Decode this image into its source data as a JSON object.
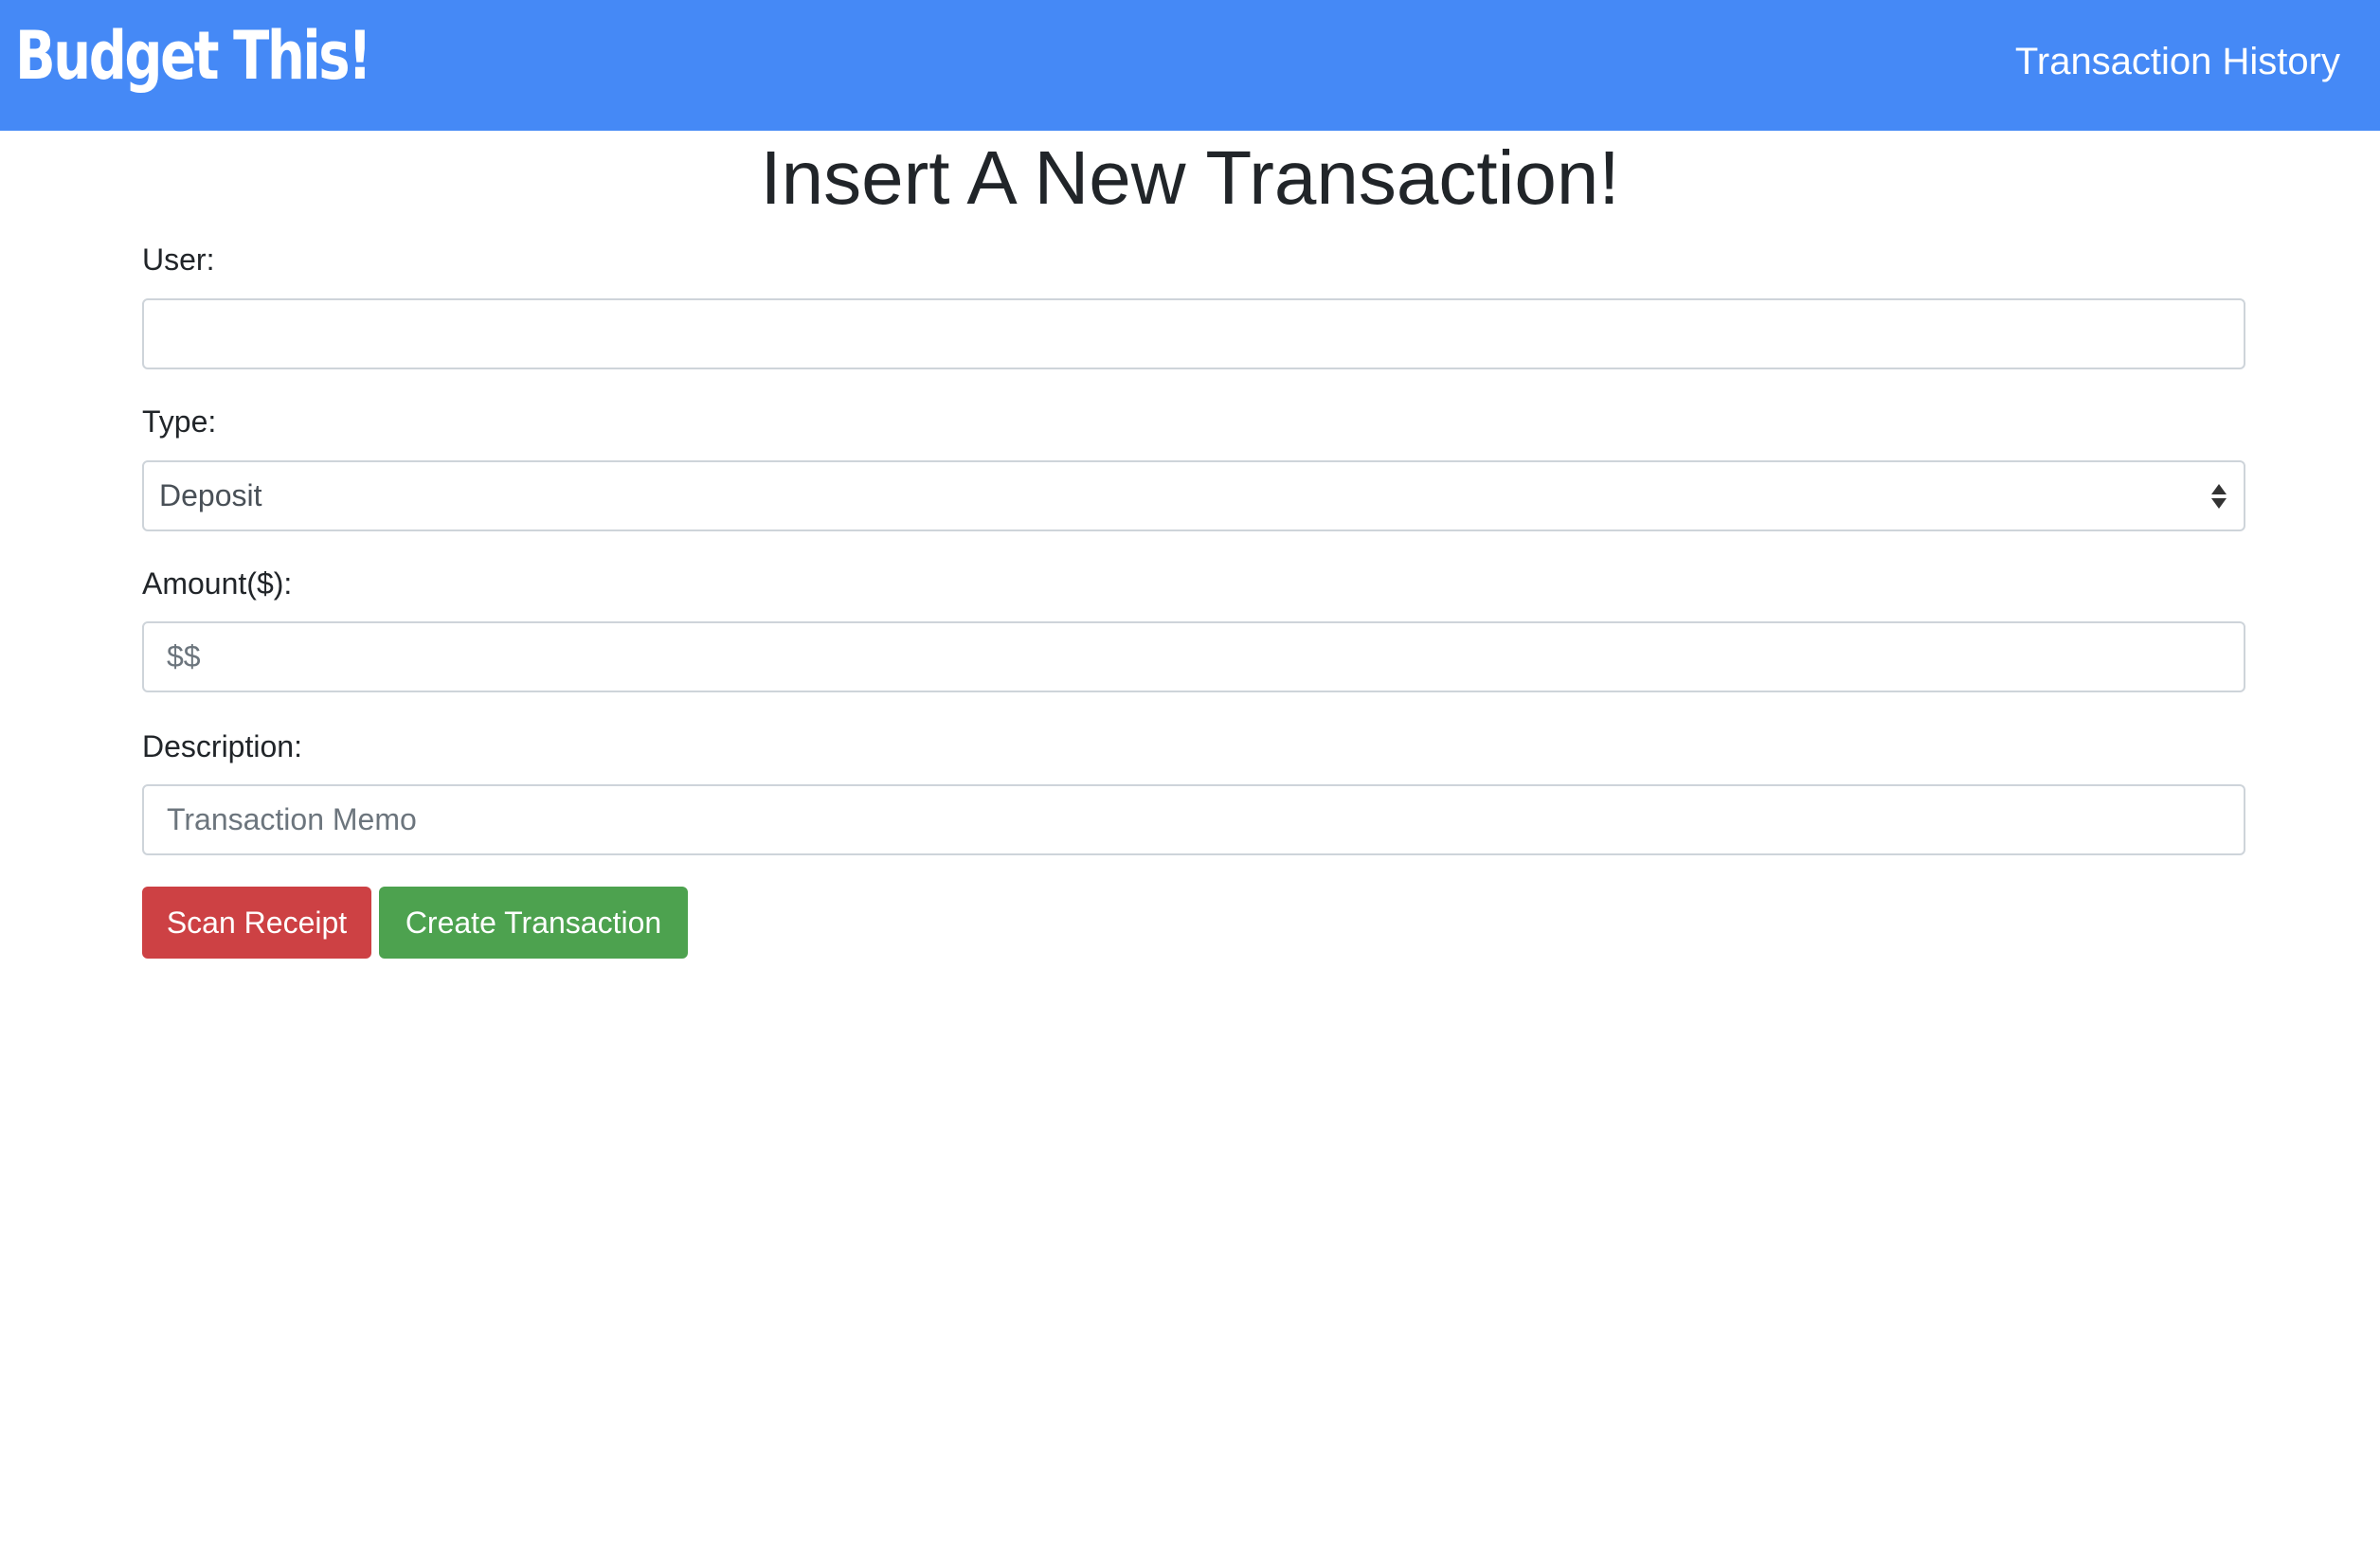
{
  "navbar": {
    "brand": "Budget This!",
    "link": "Transaction History",
    "background": "#4589f6"
  },
  "main": {
    "title": "Insert A New Transaction!"
  },
  "form": {
    "user": {
      "label": "User:",
      "value": "",
      "placeholder": ""
    },
    "type": {
      "label": "Type:",
      "selected": "Deposit"
    },
    "amount": {
      "label": "Amount($):",
      "value": "",
      "placeholder": "$$"
    },
    "description": {
      "label": "Description:",
      "value": "",
      "placeholder": "Transaction Memo"
    }
  },
  "buttons": {
    "scan_receipt": {
      "label": "Scan Receipt",
      "color": "#cd4144"
    },
    "create_transaction": {
      "label": "Create Transaction",
      "color": "#4da24f"
    }
  }
}
